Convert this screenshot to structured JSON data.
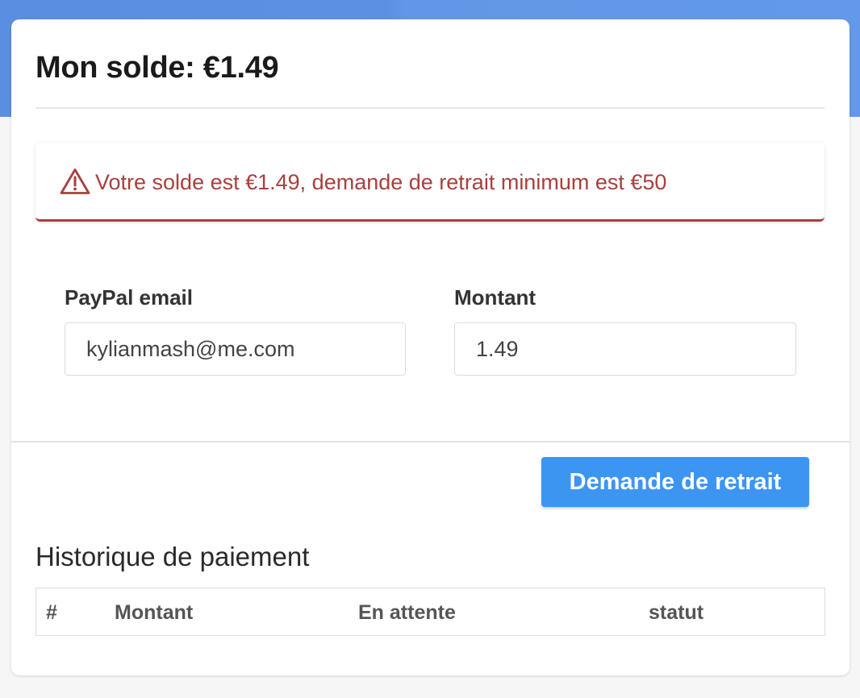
{
  "header": {
    "balance_title": "Mon solde: €1.49"
  },
  "alert": {
    "icon": "warning-triangle-icon",
    "message": "Votre solde est €1.49, demande de retrait minimum est €50",
    "color": "#a8403c"
  },
  "form": {
    "email_label": "PayPal email",
    "email_value": "kylianmash@me.com",
    "amount_label": "Montant",
    "amount_value": "1.49"
  },
  "actions": {
    "withdraw_label": "Demande de retrait",
    "button_color": "#3d95f2"
  },
  "history": {
    "title": "Historique de paiement",
    "columns": [
      "#",
      "Montant",
      "En attente",
      "statut"
    ],
    "rows": []
  },
  "colors": {
    "top_band": "#5c90e2",
    "page_background": "#f6f6f6"
  }
}
